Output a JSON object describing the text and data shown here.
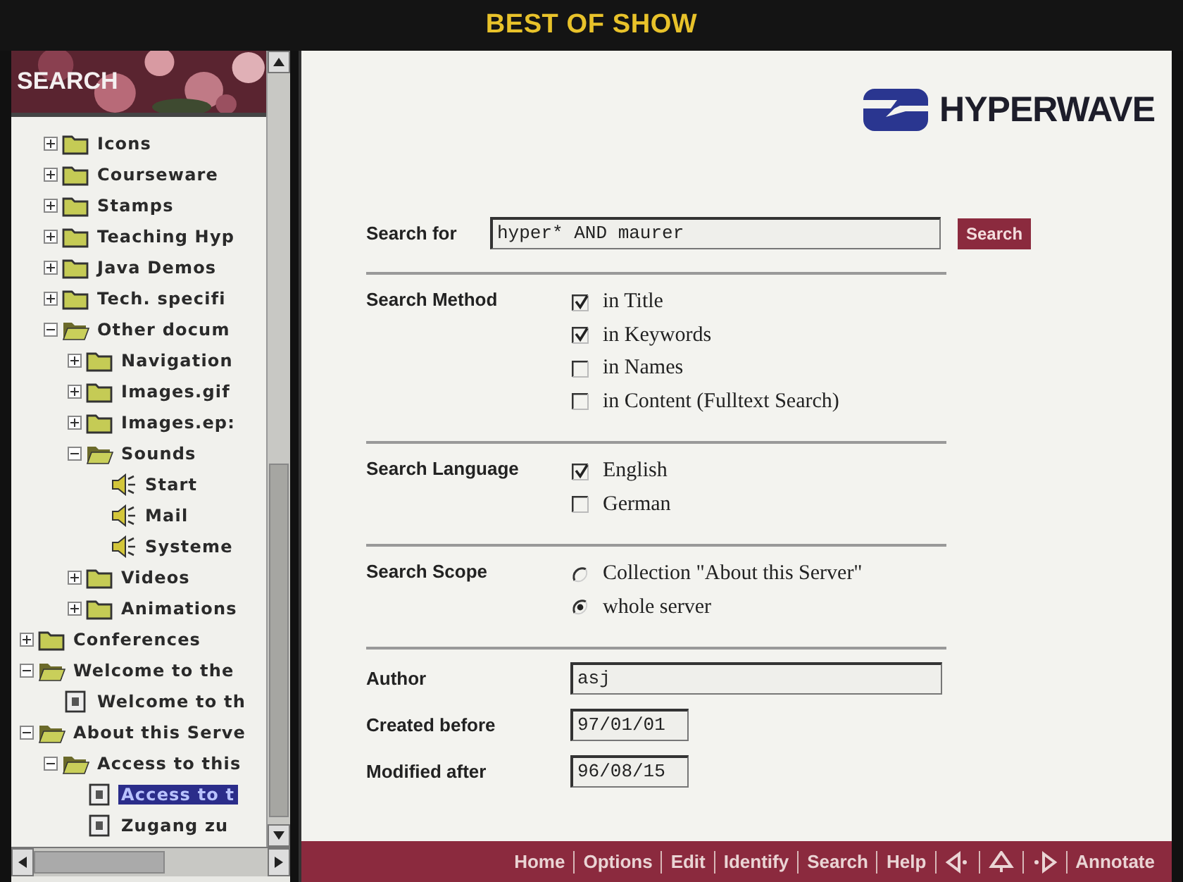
{
  "banner": {
    "title": "BEST OF SHOW"
  },
  "sidebar": {
    "header": "SEARCH",
    "tree": {
      "continued_children": [
        {
          "label": "Icons",
          "kind": "folder",
          "expanded": false,
          "selected": false
        },
        {
          "label": "Courseware",
          "kind": "folder",
          "expanded": false,
          "selected": false
        },
        {
          "label": "Stamps",
          "kind": "folder",
          "expanded": false,
          "selected": false
        },
        {
          "label": "Teaching Hyp",
          "kind": "folder",
          "expanded": false,
          "selected": false
        },
        {
          "label": "Java Demos",
          "kind": "folder",
          "expanded": false,
          "selected": false
        },
        {
          "label": "Tech. specifi",
          "kind": "folder",
          "expanded": false,
          "selected": false
        },
        {
          "label": "Other docum",
          "kind": "folder",
          "expanded": true,
          "selected": false,
          "children": [
            {
              "label": "Navigation",
              "kind": "folder",
              "expanded": false,
              "selected": false
            },
            {
              "label": "Images.gif",
              "kind": "folder",
              "expanded": false,
              "selected": false
            },
            {
              "label": "Images.ep:",
              "kind": "folder",
              "expanded": false,
              "selected": false
            },
            {
              "label": "Sounds",
              "kind": "folder",
              "expanded": true,
              "selected": false,
              "children": [
                {
                  "label": "Start",
                  "kind": "sound",
                  "selected": false
                },
                {
                  "label": "Mail",
                  "kind": "sound",
                  "selected": false
                },
                {
                  "label": "Systeme",
                  "kind": "sound",
                  "selected": false
                }
              ]
            },
            {
              "label": "Videos",
              "kind": "folder",
              "expanded": false,
              "selected": false
            },
            {
              "label": "Animations",
              "kind": "folder",
              "expanded": false,
              "selected": false
            }
          ]
        }
      ],
      "items": [
        {
          "label": "Conferences",
          "kind": "folder",
          "expanded": false,
          "selected": false
        },
        {
          "label": "Welcome to the",
          "kind": "folder",
          "expanded": true,
          "selected": false,
          "children": [
            {
              "label": "Welcome to th",
              "kind": "document",
              "selected": false
            }
          ]
        },
        {
          "label": "About this Serve",
          "kind": "folder",
          "expanded": true,
          "selected": false,
          "children": [
            {
              "label": "Access to this",
              "kind": "folder",
              "expanded": true,
              "selected": false,
              "children": [
                {
                  "label": "Access to t",
                  "kind": "document",
                  "selected": true
                },
                {
                  "label": "Zugang zu",
                  "kind": "document",
                  "selected": false
                }
              ]
            }
          ]
        }
      ]
    }
  },
  "logo": {
    "name": "HYPERWAVE"
  },
  "search": {
    "label": "Search for",
    "value": "hyper* AND maurer",
    "button": "Search"
  },
  "sections": [
    {
      "label": "Search Method",
      "kind": "checkbox",
      "options": [
        {
          "label": "in Title",
          "checked": true
        },
        {
          "label": "in Keywords",
          "checked": true
        },
        {
          "label": "in Names",
          "checked": false
        },
        {
          "label": "in Content (Fulltext Search)",
          "checked": false
        }
      ]
    },
    {
      "label": "Search Language",
      "kind": "checkbox",
      "options": [
        {
          "label": "English",
          "checked": true
        },
        {
          "label": "German",
          "checked": false
        }
      ]
    },
    {
      "label": "Search Scope",
      "kind": "radio",
      "options": [
        {
          "label": "Collection \"About this Server\"",
          "selected": false
        },
        {
          "label": "whole server",
          "selected": true
        }
      ]
    }
  ],
  "fields": [
    {
      "label": "Author",
      "value": "asj",
      "kind": "wide"
    },
    {
      "label": "Created before",
      "value": "97/01/01",
      "kind": "short"
    },
    {
      "label": "Modified after",
      "value": "96/08/15",
      "kind": "short"
    }
  ],
  "nav_bar": [
    {
      "kind": "text",
      "label": "Home"
    },
    {
      "kind": "text",
      "label": "Options"
    },
    {
      "kind": "text",
      "label": "Edit"
    },
    {
      "kind": "text",
      "label": "Identify"
    },
    {
      "kind": "text",
      "label": "Search"
    },
    {
      "kind": "text",
      "label": "Help"
    },
    {
      "kind": "back"
    },
    {
      "kind": "up"
    },
    {
      "kind": "forward"
    },
    {
      "kind": "text",
      "label": "Annotate"
    }
  ]
}
